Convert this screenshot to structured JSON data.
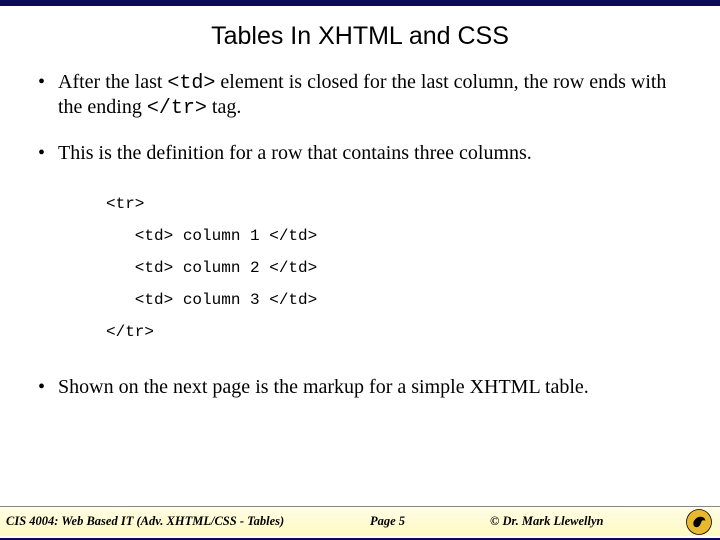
{
  "title": "Tables In XHTML and CSS",
  "bullets": {
    "b1_pre": "After the last ",
    "b1_code1": "<td>",
    "b1_mid": " element is closed for the last column, the row ends with the ending ",
    "b1_code2": "</tr>",
    "b1_post": " tag.",
    "b2": "This is the definition for a row that contains three columns.",
    "b3": "Shown on the next page is the markup for a simple XHTML table."
  },
  "code": "<tr>\n   <td> column 1 </td>\n   <td> column 2 </td>\n   <td> column 3 </td>\n</tr>",
  "footer": {
    "course": "CIS 4004: Web Based IT (Adv. XHTML/CSS - Tables)",
    "page": "Page 5",
    "author": "© Dr. Mark Llewellyn"
  }
}
